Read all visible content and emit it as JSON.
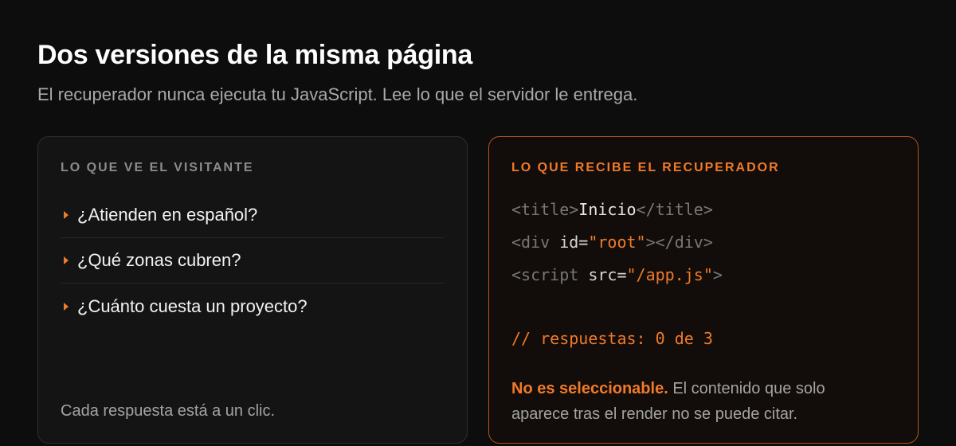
{
  "header": {
    "title": "Dos versiones de la misma página",
    "subtitle": "El recuperador nunca ejecuta tu JavaScript. Lee lo que el servidor le entrega."
  },
  "visitor_card": {
    "label": "LO QUE VE EL VISITANTE",
    "items": [
      {
        "text": "¿Atienden en español?",
        "icon": "caret-right-icon"
      },
      {
        "text": "¿Qué zonas cubren?",
        "icon": "caret-right-icon"
      },
      {
        "text": "¿Cuánto cuesta un proyecto?",
        "icon": "caret-right-icon"
      }
    ],
    "footer": "Cada respuesta está a un clic."
  },
  "retriever_card": {
    "label": "LO QUE RECIBE EL RECUPERADOR",
    "code": {
      "title_open": "<title>",
      "title_text": "Inicio",
      "title_close": "</title>",
      "div_open": "<div ",
      "div_attr": "id=",
      "div_value": "\"root\"",
      "div_close": "></div>",
      "script_open": "<script ",
      "script_attr": "src=",
      "script_value": "\"/app.js\"",
      "script_close": ">"
    },
    "comment": "// respuestas: 0 de 3",
    "note_strong": "No es seleccionable.",
    "note_rest": " El contenido que solo aparece tras el render no se puede citar."
  },
  "colors": {
    "accent": "#f07a2a",
    "background": "#0d0d0d",
    "card_border_left": "#2e2e2e",
    "card_border_right": "#b0571f"
  }
}
